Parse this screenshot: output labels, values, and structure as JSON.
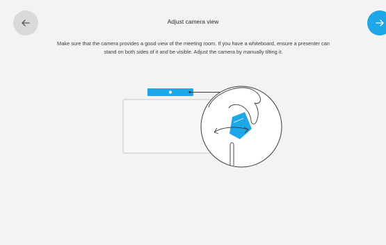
{
  "header": {
    "title": "Adjust camera view"
  },
  "body": {
    "instructions": "Make sure that the camera provides a good view of the meeting room. If you have a whiteboard, ensure a presenter can stand on both sides of it and be visible. Adjust the camera by manually tilting it."
  },
  "navigation": {
    "back_icon": "arrow-left-icon",
    "next_icon": "arrow-right-icon"
  },
  "colors": {
    "accent": "#1ea7e8",
    "back_button": "#d9d9d9",
    "background": "#f3f3f3"
  }
}
